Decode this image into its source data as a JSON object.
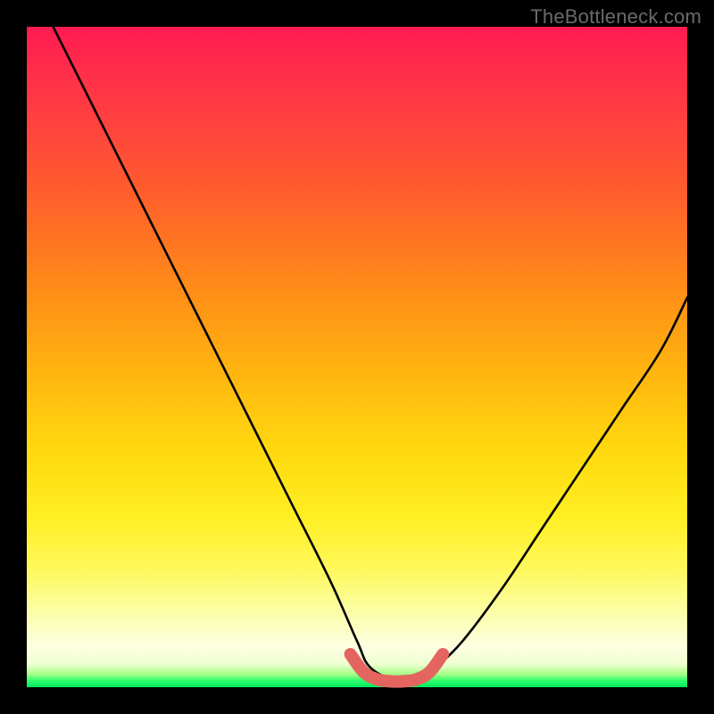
{
  "watermark": "TheBottleneck.com",
  "chart_data": {
    "type": "line",
    "title": "",
    "xlabel": "",
    "ylabel": "",
    "xlim": [
      0,
      100
    ],
    "ylim": [
      0,
      100
    ],
    "series": [
      {
        "name": "bottleneck-curve",
        "x": [
          4,
          10,
          16,
          22,
          28,
          34,
          40,
          46,
          50,
          52,
          56,
          60,
          62,
          66,
          72,
          78,
          84,
          90,
          96,
          100
        ],
        "values": [
          100,
          88,
          76,
          64,
          52,
          40,
          28,
          16,
          7,
          3,
          1,
          1,
          3,
          7,
          15,
          24,
          33,
          42,
          51,
          59
        ]
      }
    ],
    "highlight": {
      "name": "flat-bottom",
      "x": [
        49,
        51,
        53,
        55,
        57,
        59,
        61,
        63
      ],
      "values": [
        5,
        2.3,
        1.2,
        0.9,
        0.9,
        1.2,
        2.3,
        5
      ],
      "color": "#e4655f"
    }
  }
}
